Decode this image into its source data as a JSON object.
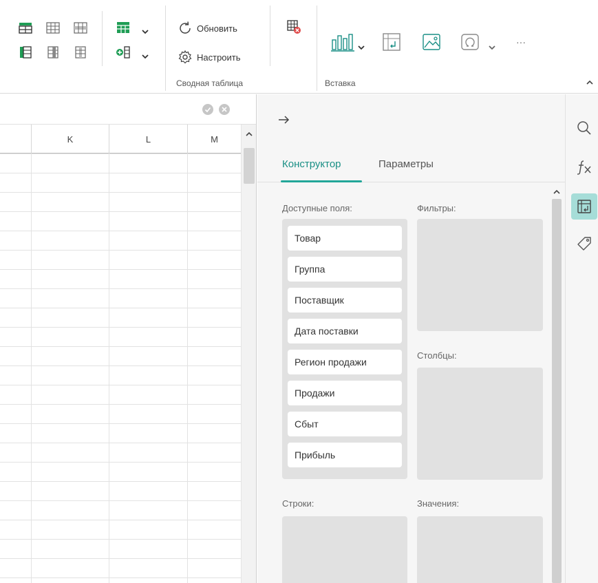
{
  "ribbon": {
    "refresh_label": "Обновить",
    "configure_label": "Настроить",
    "group_pivot_label": "Сводная таблица",
    "group_insert_label": "Вставка",
    "more_label": "···"
  },
  "sheet": {
    "columns": [
      "K",
      "L",
      "M"
    ]
  },
  "panel": {
    "tabs": [
      "Конструктор",
      "Параметры"
    ],
    "available_fields_label": "Доступные поля:",
    "filters_label": "Фильтры:",
    "columns_label": "Столбцы:",
    "rows_label": "Строки:",
    "values_label": "Значения:",
    "fields": [
      "Товар",
      "Группа",
      "Поставщик",
      "Дата поставки",
      "Регион продажи",
      "Продажи",
      "Сбыт",
      "Прибыль"
    ]
  },
  "colors": {
    "accent": "#22a699",
    "sidebar_active": "#a6ddd8",
    "drop_zone": "#e1e1e1",
    "panel_bg": "#f6f6f6"
  },
  "icons": [
    "table-layout-icon",
    "refresh-icon",
    "gear-icon",
    "chart-icon",
    "pivot-icon",
    "image-icon",
    "symbol-icon",
    "search-icon",
    "fx-icon",
    "tag-icon",
    "arrow-right-icon"
  ]
}
